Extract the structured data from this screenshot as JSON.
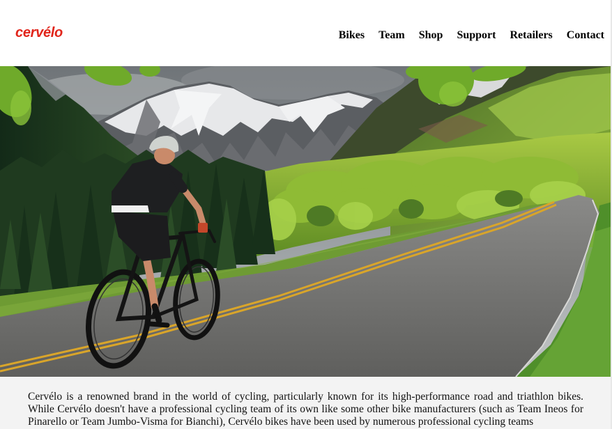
{
  "header": {
    "logo_text": "cervélo",
    "brand_color": "#e1251b",
    "nav": [
      {
        "label": "Bikes"
      },
      {
        "label": "Team"
      },
      {
        "label": "Shop"
      },
      {
        "label": "Support"
      },
      {
        "label": "Retailers"
      },
      {
        "label": "Contact"
      }
    ]
  },
  "hero": {
    "image": "cyclist-on-mountain-road-photo"
  },
  "content": {
    "paragraph": "Cervélo is a renowned brand in the world of cycling, particularly known for its high-performance road and triathlon bikes. While Cervélo doesn't have a professional cycling team of its own like some other bike manufacturers (such as Team Ineos for Pinarello or Team Jumbo-Visma for Bianchi), Cervélo bikes have been used by numerous professional cycling teams"
  }
}
